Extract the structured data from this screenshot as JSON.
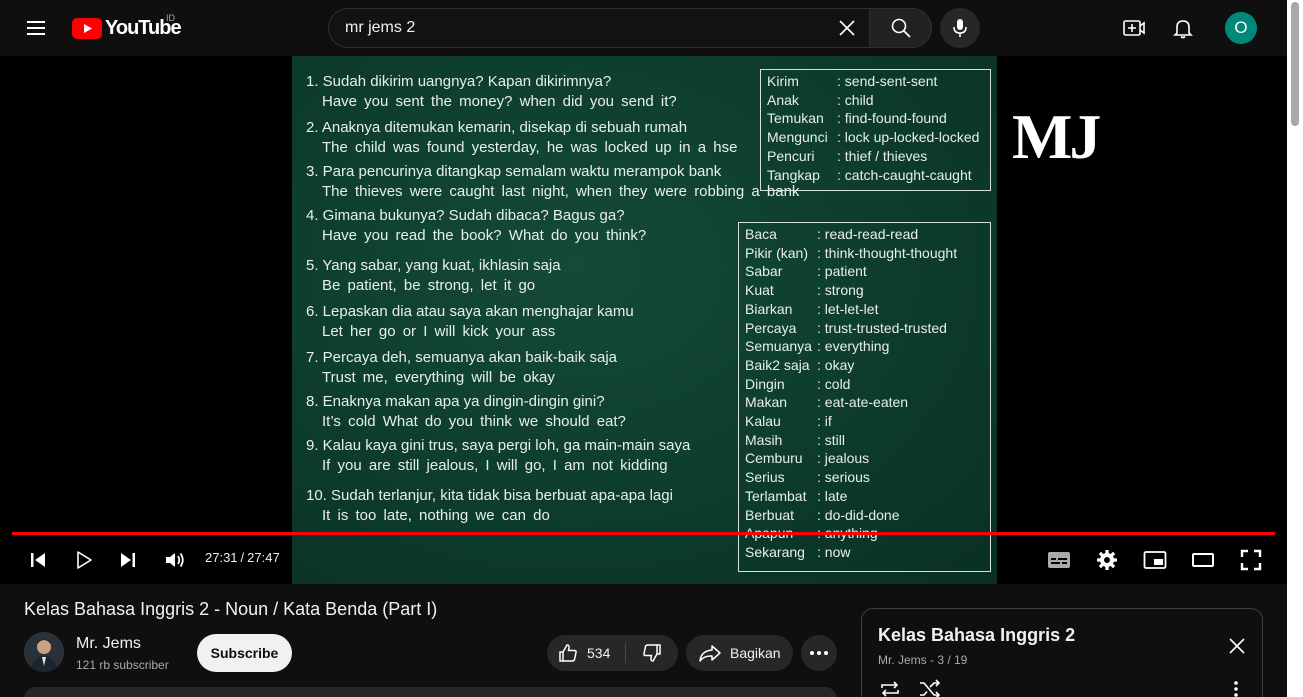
{
  "header": {
    "logo_text": "YouTube",
    "region": "ID",
    "search_value": "mr jems 2",
    "avatar_letter": "O",
    "icons": [
      "menu-icon",
      "youtube-logo-icon",
      "clear-icon",
      "search-icon",
      "mic-icon",
      "create-icon",
      "bell-icon"
    ]
  },
  "board": {
    "sentences": [
      {
        "id": "1. Sudah dikirim uangnya? Kapan dikirimnya?",
        "en": "Have you sent the money? when did you send it?"
      },
      {
        "id": "2. Anaknya ditemukan kemarin, disekap di sebuah rumah",
        "en": "The child was found yesterday, he was locked up in a hse"
      },
      {
        "id": "3. Para pencurinya ditangkap semalam waktu merampok bank",
        "en": "The thieves were caught last night, when they were robbing a bank"
      },
      {
        "id": "4. Gimana bukunya? Sudah dibaca? Bagus ga?",
        "en": "Have you read the book? What do you think?"
      },
      {
        "id": "5. Yang sabar, yang kuat, ikhlasin saja",
        "en": "Be patient, be strong, let it go"
      },
      {
        "id": "6. Lepaskan dia atau saya akan menghajar kamu",
        "en": "Let her go or I will kick your ass"
      },
      {
        "id": "7. Percaya deh, semuanya akan baik-baik saja",
        "en": "Trust me, everything will be okay"
      },
      {
        "id": "8. Enaknya makan apa ya dingin-dingin gini?",
        "en": "It’s cold What do you think we should eat?"
      },
      {
        "id": "9. Kalau kaya gini trus, saya pergi loh, ga main-main saya",
        "en": "If you are still jealous, I will go, I am not kidding"
      },
      {
        "id": "10. Sudah terlanjur, kita tidak bisa berbuat apa-apa lagi",
        "en": "It is too late, nothing we can do"
      }
    ],
    "vocab1": [
      {
        "word": "Kirim",
        "meaning": ": send-sent-sent"
      },
      {
        "word": "Anak",
        "meaning": ": child"
      },
      {
        "word": "Temukan",
        "meaning": ": find-found-found"
      },
      {
        "word": "Mengunci",
        "meaning": ": lock up-locked-locked"
      },
      {
        "word": "Pencuri",
        "meaning": ": thief / thieves"
      },
      {
        "word": "Tangkap",
        "meaning": ": catch-caught-caught"
      }
    ],
    "vocab2": [
      {
        "word": "Baca",
        "meaning": ": read-read-read"
      },
      {
        "word": "Pikir (kan)",
        "meaning": ": think-thought-thought"
      },
      {
        "word": "Sabar",
        "meaning": ": patient"
      },
      {
        "word": "Kuat",
        "meaning": ": strong"
      },
      {
        "word": "Biarkan",
        "meaning": ": let-let-let"
      },
      {
        "word": "Percaya",
        "meaning": ": trust-trusted-trusted"
      },
      {
        "word": "Semuanya",
        "meaning": ": everything"
      },
      {
        "word": "Baik2 saja",
        "meaning": ": okay"
      },
      {
        "word": "Dingin",
        "meaning": ": cold"
      },
      {
        "word": "Makan",
        "meaning": ": eat-ate-eaten"
      },
      {
        "word": "Kalau",
        "meaning": ": if"
      },
      {
        "word": "Masih",
        "meaning": ": still"
      },
      {
        "word": "Cemburu",
        "meaning": ": jealous"
      },
      {
        "word": "Serius",
        "meaning": ": serious"
      },
      {
        "word": "Terlambat",
        "meaning": ": late"
      },
      {
        "word": "Berbuat",
        "meaning": ": do-did-done"
      },
      {
        "word": "Apapun",
        "meaning": ": anything"
      },
      {
        "word": "Sekarang",
        "meaning": ": now"
      }
    ],
    "watermark": "MJ"
  },
  "player": {
    "current_time": "27:31",
    "separator": "/",
    "duration": "27:47",
    "progress_fraction": 1.0,
    "progress_color": "#ff0000",
    "icons": [
      "previous-icon",
      "play-icon",
      "next-icon",
      "volume-icon",
      "subtitles-icon",
      "settings-icon",
      "miniplayer-icon",
      "theater-icon",
      "fullscreen-icon"
    ]
  },
  "video": {
    "title": "Kelas Bahasa Inggris 2 - Noun / Kata Benda (Part I)",
    "channel_name": "Mr. Jems",
    "channel_subs": "121 rb subscriber",
    "subscribe_label": "Subscribe",
    "like_count": "534",
    "share_label": "Bagikan"
  },
  "playlist": {
    "title": "Kelas Bahasa Inggris 2",
    "meta": "Mr. Jems - 3 / 19"
  }
}
